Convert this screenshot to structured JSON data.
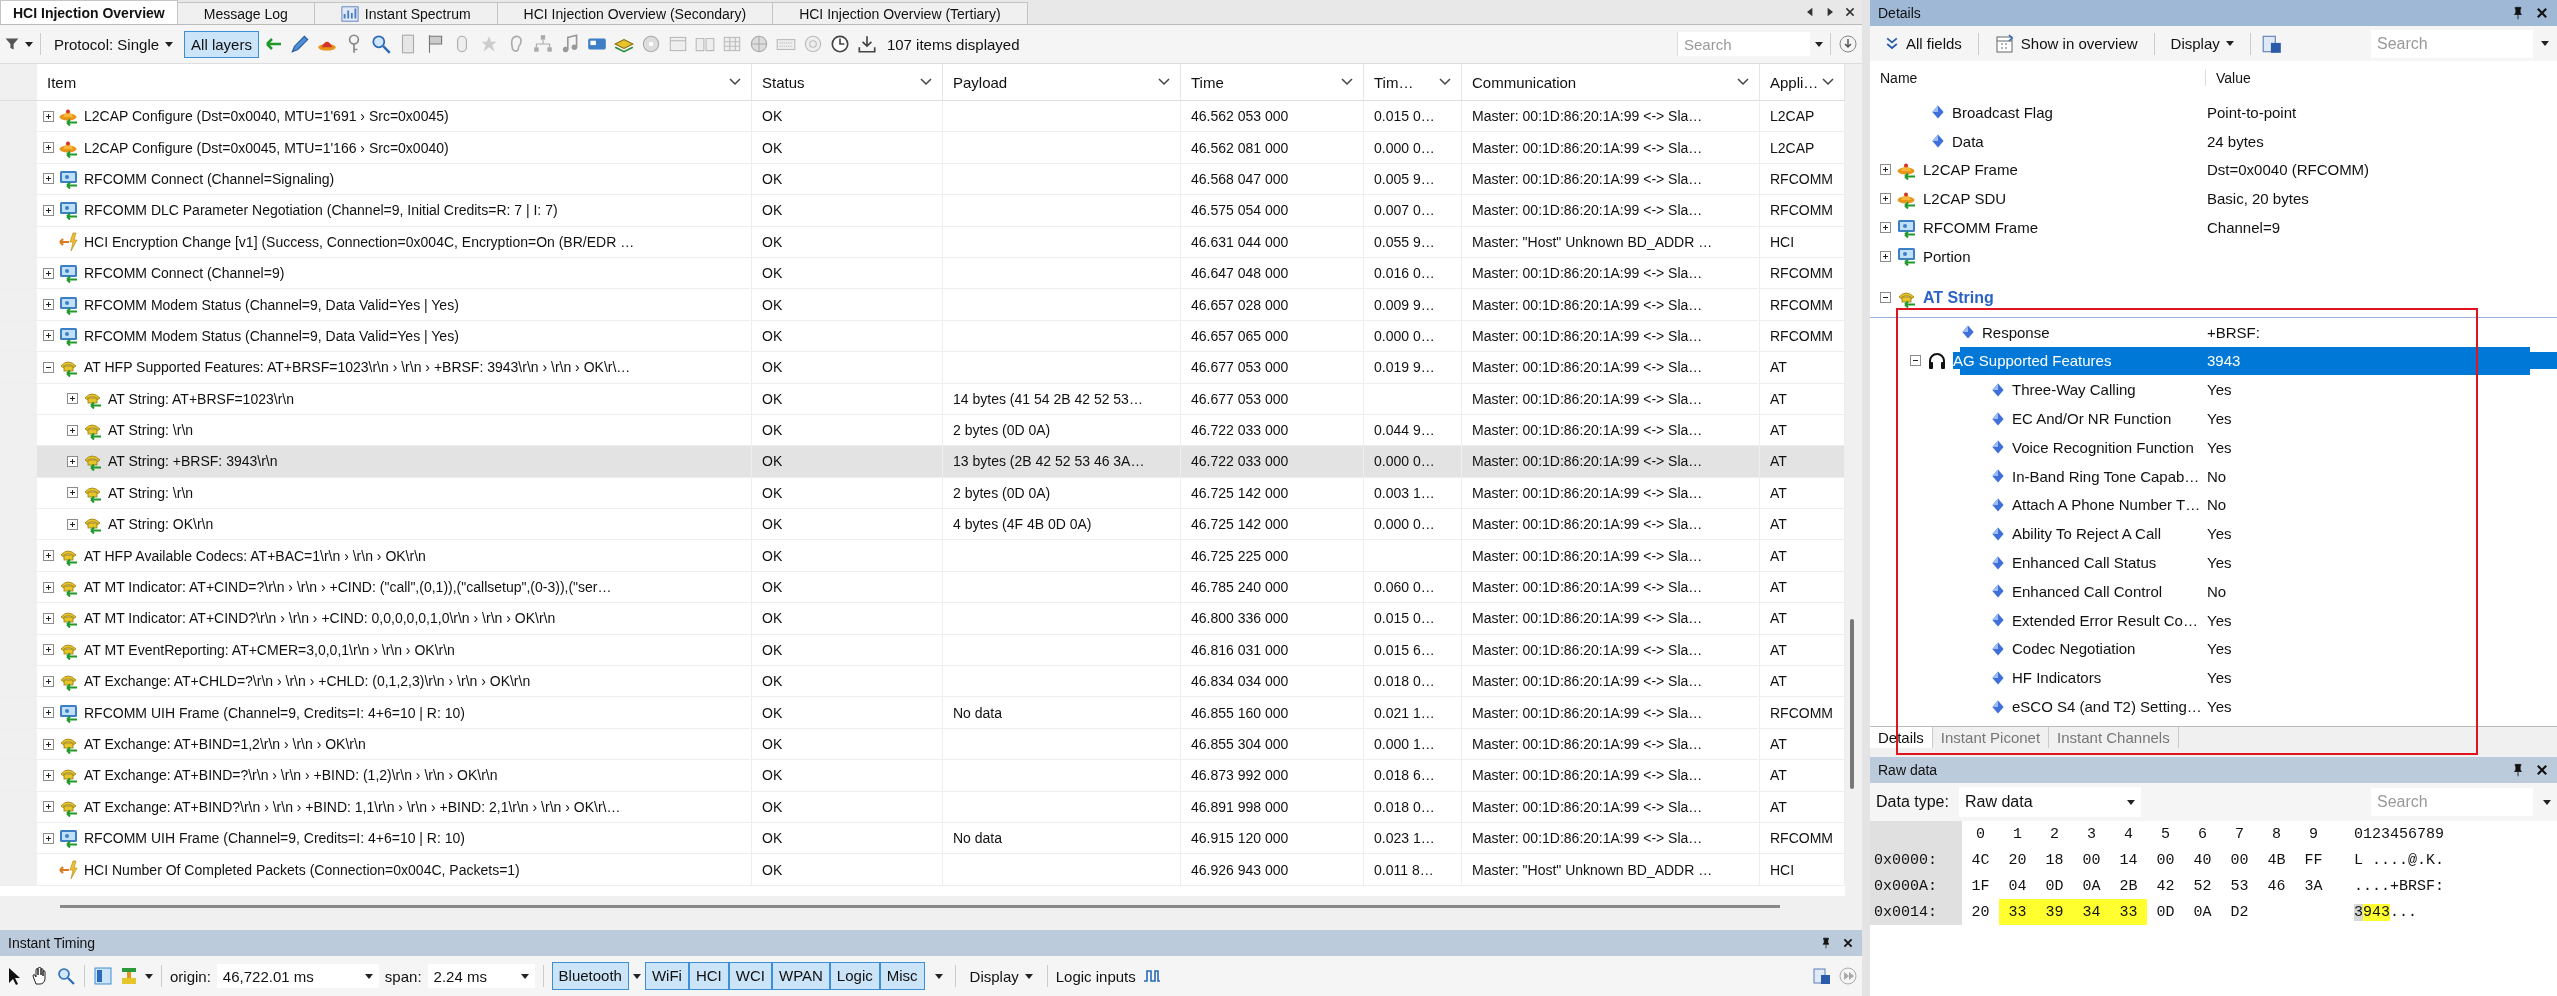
{
  "tabs": [
    {
      "label": "HCI Injection Overview",
      "selected": true,
      "kind": "text"
    },
    {
      "label": "Message Log",
      "selected": false,
      "kind": "text"
    },
    {
      "label": "Instant Spectrum",
      "selected": false,
      "kind": "chart"
    },
    {
      "label": "HCI Injection Overview (Secondary)",
      "selected": false,
      "kind": "text"
    },
    {
      "label": "HCI Injection Overview (Tertiary)",
      "selected": false,
      "kind": "text"
    }
  ],
  "toolbar": {
    "protocol": "Protocol: Single",
    "all_layers": {
      "label": "All layers",
      "on": true
    },
    "count": "107 items displayed",
    "search_placeholder": "Search"
  },
  "table": {
    "columns": [
      "Item",
      "Status",
      "Payload",
      "Time",
      "Tim…",
      "Communication",
      "Appli…"
    ],
    "rows": [
      {
        "kind": "l2cap",
        "item": "L2CAP Configure (Dst=0x0040, MTU=1'691 › Src=0x0045)",
        "status": "OK",
        "time": "46.562 053 000",
        "delta": "0.015 0…",
        "communication": "Master: 00:1D:86:20:1A:99 <-> Sla…",
        "application": "L2CAP",
        "expanded": false,
        "selected": false
      },
      {
        "kind": "l2cap",
        "item": "L2CAP Configure (Dst=0x0045, MTU=1'166 › Src=0x0040)",
        "status": "OK",
        "time": "46.562 081 000",
        "delta": "0.000 0…",
        "communication": "Master: 00:1D:86:20:1A:99 <-> Sla…",
        "application": "L2CAP",
        "expanded": false,
        "selected": false
      },
      {
        "kind": "rfcomm",
        "item": "RFCOMM Connect (Channel=Signaling)",
        "status": "OK",
        "time": "46.568 047 000",
        "delta": "0.005 9…",
        "communication": "Master: 00:1D:86:20:1A:99 <-> Sla…",
        "application": "RFCOMM",
        "expanded": false,
        "selected": false
      },
      {
        "kind": "rfcomm",
        "item": "RFCOMM DLC Parameter Negotiation (Channel=9, Initial Credits=R: 7 | I: 7)",
        "status": "OK",
        "time": "46.575 054 000",
        "delta": "0.007 0…",
        "communication": "Master: 00:1D:86:20:1A:99 <-> Sla…",
        "application": "RFCOMM",
        "expanded": false,
        "selected": false
      },
      {
        "kind": "hci",
        "item": "HCI Encryption Change [v1] (Success, Connection=0x004C, Encryption=On (BR/EDR …",
        "status": "OK",
        "time": "46.631 044 000",
        "delta": "0.055 9…",
        "communication": "Master: \"Host\" Unknown BD_ADDR …",
        "application": "HCI",
        "selected": false
      },
      {
        "kind": "rfcomm",
        "item": "RFCOMM Connect (Channel=9)",
        "status": "OK",
        "time": "46.647 048 000",
        "delta": "0.016 0…",
        "communication": "Master: 00:1D:86:20:1A:99 <-> Sla…",
        "application": "RFCOMM",
        "expanded": false,
        "selected": false
      },
      {
        "kind": "rfcomm",
        "item": "RFCOMM Modem Status (Channel=9, Data Valid=Yes | Yes)",
        "status": "OK",
        "time": "46.657 028 000",
        "delta": "0.009 9…",
        "communication": "Master: 00:1D:86:20:1A:99 <-> Sla…",
        "application": "RFCOMM",
        "expanded": false,
        "selected": false
      },
      {
        "kind": "rfcomm",
        "item": "RFCOMM Modem Status (Channel=9, Data Valid=Yes | Yes)",
        "status": "OK",
        "time": "46.657 065 000",
        "delta": "0.000 0…",
        "communication": "Master: 00:1D:86:20:1A:99 <-> Sla…",
        "application": "RFCOMM",
        "expanded": false,
        "selected": false
      },
      {
        "kind": "at",
        "item": "AT HFP Supported Features: AT+BRSF=1023\\r\\n › \\r\\n › +BRSF: 3943\\r\\n › \\r\\n › OK\\r\\…",
        "status": "OK",
        "time": "46.677 053 000",
        "delta": "0.019 9…",
        "communication": "Master: 00:1D:86:20:1A:99 <-> Sla…",
        "application": "AT",
        "expanded": true,
        "selected": false,
        "children": [
          {
            "kind": "at",
            "item": "AT String: AT+BRSF=1023\\r\\n",
            "status": "OK",
            "payload": "14 bytes (41 54 2B 42 52 53…",
            "time": "46.677 053 000",
            "communication": "Master: 00:1D:86:20:1A:99 <-> Sla…",
            "application": "AT",
            "expanded": false,
            "selected": false
          },
          {
            "kind": "at",
            "item": "AT String: \\r\\n",
            "status": "OK",
            "payload": "2 bytes (0D 0A)",
            "time": "46.722 033 000",
            "delta": "0.044 9…",
            "communication": "Master: 00:1D:86:20:1A:99 <-> Sla…",
            "application": "AT",
            "expanded": false,
            "selected": false
          },
          {
            "kind": "at",
            "item": "AT String: +BRSF: 3943\\r\\n",
            "status": "OK",
            "payload": "13 bytes (2B 42 52 53 46 3A…",
            "time": "46.722 033 000",
            "delta": "0.000 0…",
            "communication": "Master: 00:1D:86:20:1A:99 <-> Sla…",
            "application": "AT",
            "expanded": false,
            "selected": true
          },
          {
            "kind": "at",
            "item": "AT String: \\r\\n",
            "status": "OK",
            "payload": "2 bytes (0D 0A)",
            "time": "46.725 142 000",
            "delta": "0.003 1…",
            "communication": "Master: 00:1D:86:20:1A:99 <-> Sla…",
            "application": "AT",
            "expanded": false,
            "selected": false
          },
          {
            "kind": "at",
            "item": "AT String: OK\\r\\n",
            "status": "OK",
            "payload": "4 bytes (4F 4B 0D 0A)",
            "time": "46.725 142 000",
            "delta": "0.000 0…",
            "communication": "Master: 00:1D:86:20:1A:99 <-> Sla…",
            "application": "AT",
            "expanded": false,
            "selected": false
          }
        ]
      },
      {
        "kind": "at",
        "item": "AT HFP Available Codecs: AT+BAC=1\\r\\n › \\r\\n › OK\\r\\n",
        "status": "OK",
        "time": "46.725 225 000",
        "communication": "Master: 00:1D:86:20:1A:99 <-> Sla…",
        "application": "AT",
        "expanded": false,
        "selected": false
      },
      {
        "kind": "at",
        "item": "AT MT Indicator: AT+CIND=?\\r\\n › \\r\\n › +CIND: (\"call\",(0,1)),(\"callsetup\",(0-3)),(\"ser…",
        "status": "OK",
        "time": "46.785 240 000",
        "delta": "0.060 0…",
        "communication": "Master: 00:1D:86:20:1A:99 <-> Sla…",
        "application": "AT",
        "expanded": false,
        "selected": false
      },
      {
        "kind": "at",
        "item": "AT MT Indicator: AT+CIND?\\r\\n › \\r\\n › +CIND: 0,0,0,0,0,1,0\\r\\n › \\r\\n › OK\\r\\n",
        "status": "OK",
        "time": "46.800 336 000",
        "delta": "0.015 0…",
        "communication": "Master: 00:1D:86:20:1A:99 <-> Sla…",
        "application": "AT",
        "expanded": false,
        "selected": false
      },
      {
        "kind": "at",
        "item": "AT MT EventReporting: AT+CMER=3,0,0,1\\r\\n › \\r\\n › OK\\r\\n",
        "status": "OK",
        "time": "46.816 031 000",
        "delta": "0.015 6…",
        "communication": "Master: 00:1D:86:20:1A:99 <-> Sla…",
        "application": "AT",
        "expanded": false,
        "selected": false
      },
      {
        "kind": "at",
        "item": "AT Exchange: AT+CHLD=?\\r\\n › \\r\\n › +CHLD: (0,1,2,3)\\r\\n › \\r\\n › OK\\r\\n",
        "status": "OK",
        "time": "46.834 034 000",
        "delta": "0.018 0…",
        "communication": "Master: 00:1D:86:20:1A:99 <-> Sla…",
        "application": "AT",
        "expanded": false,
        "selected": false
      },
      {
        "kind": "rfcomm",
        "item": "RFCOMM UIH Frame (Channel=9, Credits=I: 4+6=10 | R: 10)",
        "status": "OK",
        "payload": "No data",
        "time": "46.855 160 000",
        "delta": "0.021 1…",
        "communication": "Master: 00:1D:86:20:1A:99 <-> Sla…",
        "application": "RFCOMM",
        "expanded": false,
        "selected": false
      },
      {
        "kind": "at",
        "item": "AT Exchange: AT+BIND=1,2\\r\\n › \\r\\n › OK\\r\\n",
        "status": "OK",
        "time": "46.855 304 000",
        "delta": "0.000 1…",
        "communication": "Master: 00:1D:86:20:1A:99 <-> Sla…",
        "application": "AT",
        "expanded": false,
        "selected": false
      },
      {
        "kind": "at",
        "item": "AT Exchange: AT+BIND=?\\r\\n › \\r\\n › +BIND: (1,2)\\r\\n › \\r\\n › OK\\r\\n",
        "status": "OK",
        "time": "46.873 992 000",
        "delta": "0.018 6…",
        "communication": "Master: 00:1D:86:20:1A:99 <-> Sla…",
        "application": "AT",
        "expanded": false,
        "selected": false
      },
      {
        "kind": "at",
        "item": "AT Exchange: AT+BIND?\\r\\n › \\r\\n › +BIND: 1,1\\r\\n › \\r\\n › +BIND: 2,1\\r\\n › \\r\\n › OK\\r\\…",
        "status": "OK",
        "time": "46.891 998 000",
        "delta": "0.018 0…",
        "communication": "Master: 00:1D:86:20:1A:99 <-> Sla…",
        "application": "AT",
        "expanded": false,
        "selected": false
      },
      {
        "kind": "rfcomm",
        "item": "RFCOMM UIH Frame (Channel=9, Credits=I: 4+6=10 | R: 10)",
        "status": "OK",
        "payload": "No data",
        "time": "46.915 120 000",
        "delta": "0.023 1…",
        "communication": "Master: 00:1D:86:20:1A:99 <-> Sla…",
        "application": "RFCOMM",
        "expanded": false,
        "selected": false
      },
      {
        "kind": "hci",
        "item": "HCI Number Of Completed Packets (Connection=0x004C, Packets=1)",
        "status": "OK",
        "time": "46.926 943 000",
        "delta": "0.011 8…",
        "communication": "Master: \"Host\" Unknown BD_ADDR …",
        "application": "HCI",
        "selected": false
      }
    ]
  },
  "timing": {
    "title": "Instant Timing",
    "origin_label": "origin:",
    "origin": "46,722.01 ms",
    "span_label": "span:",
    "span": "2.24 ms",
    "filters": [
      {
        "label": "Bluetooth",
        "on": true,
        "menu": true
      },
      {
        "label": "WiFi",
        "on": true,
        "menu": false
      },
      {
        "label": "HCI",
        "on": true,
        "menu": false
      },
      {
        "label": "WCI",
        "on": true,
        "menu": false
      },
      {
        "label": "WPAN",
        "on": true,
        "menu": false
      },
      {
        "label": "Logic",
        "on": true,
        "menu": false
      },
      {
        "label": "Misc",
        "on": true,
        "menu": false
      }
    ],
    "display": "Display",
    "logic_inputs": "Logic inputs"
  },
  "details": {
    "title": "Details",
    "all_fields": "All fields",
    "show_in_overview": "Show in overview",
    "display": "Display",
    "search_placeholder": "Search",
    "columns": [
      "Name",
      "Value"
    ],
    "tree": [
      {
        "kind": "field",
        "name": "Broadcast Flag",
        "value": "Point-to-point",
        "selected": false
      },
      {
        "kind": "field",
        "name": "Data",
        "value": "24 bytes",
        "selected": false
      },
      {
        "kind": "l2cap",
        "name": "L2CAP Frame",
        "value": "Dst=0x0040 (RFCOMM)",
        "expanded": false,
        "selected": false
      },
      {
        "kind": "l2cap",
        "name": "L2CAP SDU",
        "value": "Basic, 20 bytes",
        "expanded": false,
        "selected": false
      },
      {
        "kind": "rfcomm",
        "name": "RFCOMM Frame",
        "value": "Channel=9",
        "expanded": false,
        "selected": false
      },
      {
        "kind": "rfcomm",
        "name": "Portion",
        "expanded": false,
        "selected": false
      },
      {
        "kind": "header",
        "name": "AT String",
        "expanded": true,
        "selected": false,
        "children": [
          {
            "kind": "field",
            "name": "Response",
            "value": "+BRSF:",
            "selected": false
          },
          {
            "kind": "headset",
            "name": "AG Supported Features",
            "value": "3943",
            "expanded": true,
            "selected": true,
            "children": [
              {
                "kind": "field",
                "name": "Three-Way Calling",
                "value": "Yes",
                "selected": false
              },
              {
                "kind": "field",
                "name": "EC And/Or NR Function",
                "value": "Yes",
                "selected": false
              },
              {
                "kind": "field",
                "name": "Voice Recognition Function",
                "value": "Yes",
                "selected": false
              },
              {
                "kind": "field",
                "name": "In-Band Ring Tone Capab…",
                "value": "No",
                "selected": false
              },
              {
                "kind": "field",
                "name": "Attach A Phone Number T…",
                "value": "No",
                "selected": false
              },
              {
                "kind": "field",
                "name": "Ability To Reject A Call",
                "value": "Yes",
                "selected": false
              },
              {
                "kind": "field",
                "name": "Enhanced Call Status",
                "value": "Yes",
                "selected": false
              },
              {
                "kind": "field",
                "name": "Enhanced Call Control",
                "value": "No",
                "selected": false
              },
              {
                "kind": "field",
                "name": "Extended Error Result Co…",
                "value": "Yes",
                "selected": false
              },
              {
                "kind": "field",
                "name": "Codec Negotiation",
                "value": "Yes",
                "selected": false
              },
              {
                "kind": "field",
                "name": "HF Indicators",
                "value": "Yes",
                "selected": false
              },
              {
                "kind": "field",
                "name": "eSCO S4 (and T2) Setting…",
                "value": "Yes",
                "selected": false
              }
            ]
          }
        ]
      }
    ],
    "tabs": [
      {
        "label": "Details",
        "selected": true
      },
      {
        "label": "Instant Piconet",
        "selected": false
      },
      {
        "label": "Instant Channels",
        "selected": false
      }
    ]
  },
  "raw_data": {
    "title": "Raw data",
    "data_type_label": "Data type:",
    "data_type": "Raw data",
    "search_placeholder": "Search",
    "columns": [
      "0",
      "1",
      "2",
      "3",
      "4",
      "5",
      "6",
      "7",
      "8",
      "9"
    ],
    "ascii_header": "0123456789",
    "rows": [
      {
        "offset": "0x0000:",
        "bytes": [
          {
            "text": "4C",
            "highlighted": false
          },
          {
            "text": "20",
            "highlighted": false
          },
          {
            "text": "18",
            "highlighted": false
          },
          {
            "text": "00",
            "highlighted": false
          },
          {
            "text": "14",
            "highlighted": false
          },
          {
            "text": "00",
            "highlighted": false
          },
          {
            "text": "40",
            "highlighted": false
          },
          {
            "text": "00",
            "highlighted": false
          },
          {
            "text": "4B",
            "highlighted": false
          },
          {
            "text": "FF",
            "highlighted": false
          }
        ],
        "ascii": [
          {
            "text": "L ....@.K.",
            "highlighted": false,
            "cursor": false
          }
        ]
      },
      {
        "offset": "0x000A:",
        "bytes": [
          {
            "text": "1F",
            "highlighted": false
          },
          {
            "text": "04",
            "highlighted": false
          },
          {
            "text": "0D",
            "highlighted": false
          },
          {
            "text": "0A",
            "highlighted": false
          },
          {
            "text": "2B",
            "highlighted": false
          },
          {
            "text": "42",
            "highlighted": false
          },
          {
            "text": "52",
            "highlighted": false
          },
          {
            "text": "53",
            "highlighted": false
          },
          {
            "text": "46",
            "highlighted": false
          },
          {
            "text": "3A",
            "highlighted": false
          }
        ],
        "ascii": [
          {
            "text": "....+BRSF:",
            "highlighted": false,
            "cursor": false
          }
        ]
      },
      {
        "offset": "0x0014:",
        "bytes": [
          {
            "text": "20",
            "highlighted": false
          },
          {
            "text": "33",
            "highlighted": true
          },
          {
            "text": "39",
            "highlighted": true
          },
          {
            "text": "34",
            "highlighted": true
          },
          {
            "text": "33",
            "highlighted": true
          },
          {
            "text": "0D",
            "highlighted": false
          },
          {
            "text": "0A",
            "highlighted": false
          },
          {
            "text": "D2",
            "highlighted": false
          }
        ],
        "ascii": [
          {
            "text": "3",
            "highlighted": false,
            "cursor": true
          },
          {
            "text": "943",
            "highlighted": true,
            "cursor": false
          },
          {
            "text": "...",
            "highlighted": false,
            "cursor": false
          }
        ]
      }
    ]
  }
}
